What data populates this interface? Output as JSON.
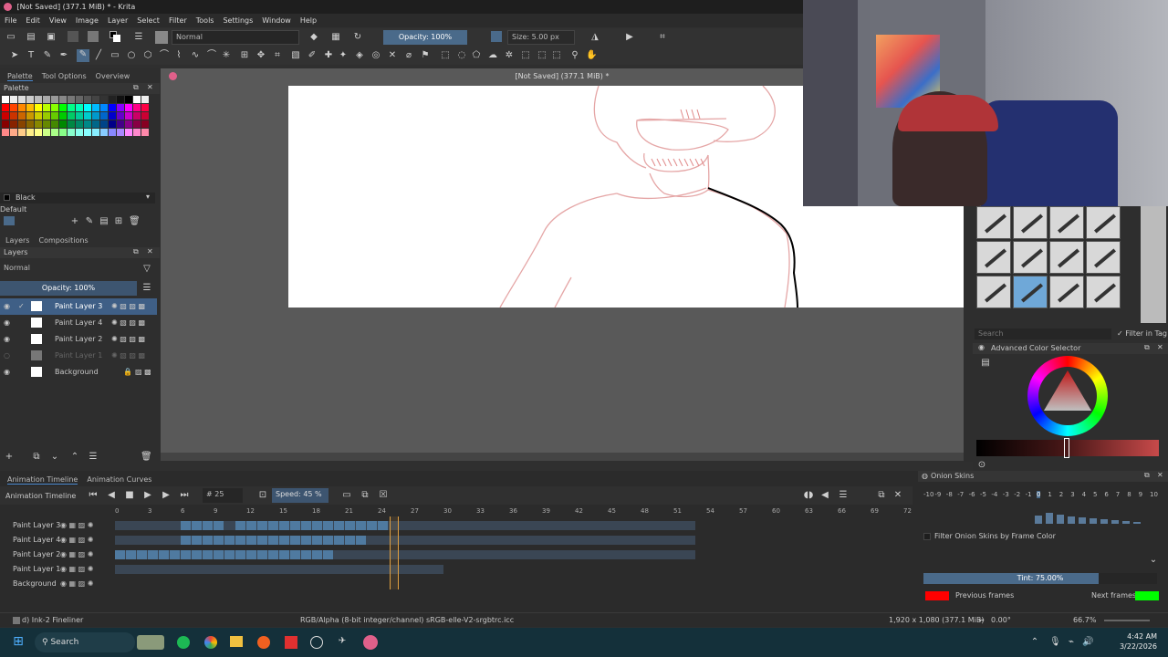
{
  "window": {
    "title": "[Not Saved]  (377.1 MiB) * - Krita"
  },
  "menu": [
    "File",
    "Edit",
    "View",
    "Image",
    "Layer",
    "Select",
    "Filter",
    "Tools",
    "Settings",
    "Window",
    "Help"
  ],
  "toolbar": {
    "blend_mode": "Normal",
    "opacity": "Opacity: 100%",
    "size": "Size: 5.00 px"
  },
  "docker_tabs": [
    "Palette",
    "Tool Options",
    "Overview"
  ],
  "palette": {
    "title": "Palette",
    "current_color": "Black",
    "set_name": "Default"
  },
  "layers_tabs": [
    "Layers",
    "Compositions"
  ],
  "layers": {
    "blend_mode": "Normal",
    "opacity": "Opacity: 100%",
    "items": [
      "Paint Layer 3",
      "Paint Layer 4",
      "Paint Layer 2",
      "Paint Layer 1",
      "Background"
    ]
  },
  "canvas": {
    "title": "[Not Saved]  (377.1 MiB) *"
  },
  "right": {
    "search_placeholder": "Search",
    "filter_tag": "Filter in Tag",
    "color_selector_title": "Advanced Color Selector"
  },
  "timeline": {
    "tabs": [
      "Animation Timeline",
      "Animation Curves"
    ],
    "label": "Animation Timeline",
    "frame": "25",
    "speed": "Speed: 45 %",
    "ruler": [
      "0",
      "3",
      "6",
      "9",
      "12",
      "15",
      "18",
      "21",
      "24",
      "27",
      "30",
      "33",
      "36",
      "39",
      "42",
      "45",
      "48",
      "51",
      "54",
      "57",
      "60",
      "63",
      "66",
      "69",
      "72"
    ],
    "layers": [
      "Paint Layer 3",
      "Paint Layer 4",
      "Paint Layer 2",
      "Paint Layer 1",
      "Background"
    ]
  },
  "onion": {
    "title": "Onion Skins",
    "numbers": [
      "-10",
      "-9",
      "-8",
      "-7",
      "-6",
      "-5",
      "-4",
      "-3",
      "-2",
      "-1",
      "0",
      "1",
      "2",
      "3",
      "4",
      "5",
      "6",
      "7",
      "8",
      "9",
      "10"
    ],
    "filter_label": "Filter Onion Skins by Frame Color",
    "tint": "Tint: 75.00%",
    "previous": "Previous frames",
    "next": "Next frames",
    "previous_color": "#ff0000",
    "next_color": "#00ff00"
  },
  "status": {
    "brush": "d) Ink-2 Fineliner",
    "color_space": "RGB/Alpha (8-bit integer/channel)  sRGB-elle-V2-srgbtrc.icc",
    "dimensions": "1,920 x 1,080 (377.1 MiB)",
    "rotation": "0.00°",
    "zoom": "66.7%"
  },
  "taskbar": {
    "search": "Search",
    "time": "4:42 AM",
    "date": "3/22/2026"
  }
}
